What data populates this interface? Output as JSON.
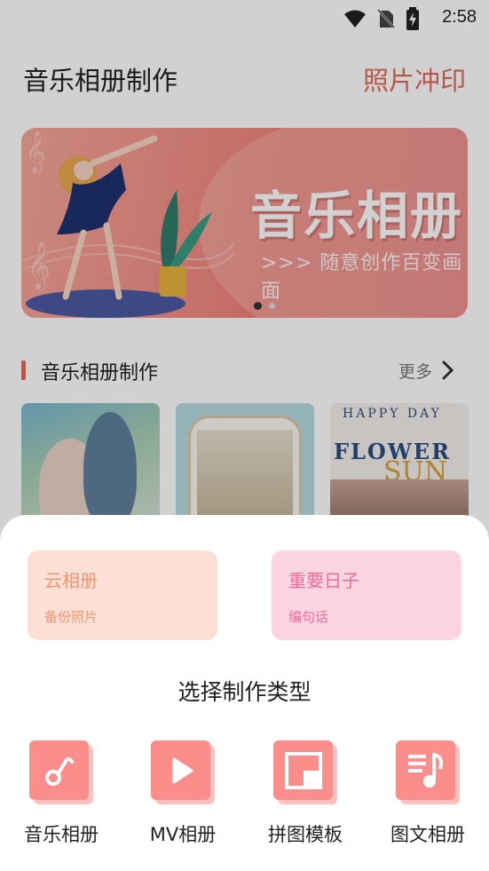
{
  "status_bar": {
    "time": "2:58"
  },
  "header": {
    "title": "音乐相册制作",
    "print_link": "照片冲印"
  },
  "banner": {
    "headline": "音乐相册",
    "tagline": ">>>  随意创作百变画面",
    "active_slide": 1,
    "slide_count": 2
  },
  "section": {
    "title": "音乐相册制作",
    "more": "更多"
  },
  "templates": {
    "t3_top": "HAPPY DAY",
    "t3_mid": "FLOWER",
    "t3_accent": "SUN"
  },
  "sheet": {
    "cards": [
      {
        "title": "云相册",
        "subtitle": "备份照片"
      },
      {
        "title": "重要日子",
        "subtitle": "编句话"
      }
    ],
    "title": "选择制作类型",
    "types": [
      {
        "label": "音乐相册",
        "icon": "music-note-icon"
      },
      {
        "label": "MV相册",
        "icon": "play-icon"
      },
      {
        "label": "拼图模板",
        "icon": "collage-icon"
      },
      {
        "label": "图文相册",
        "icon": "text-music-icon"
      }
    ]
  },
  "colors": {
    "accent": "#e06a5c",
    "icon_tile": "#fb8e8b",
    "icon_tile_shadow": "#fdc2c0",
    "cloud_card": "#fde0d5",
    "days_card": "#fdd4e2"
  }
}
